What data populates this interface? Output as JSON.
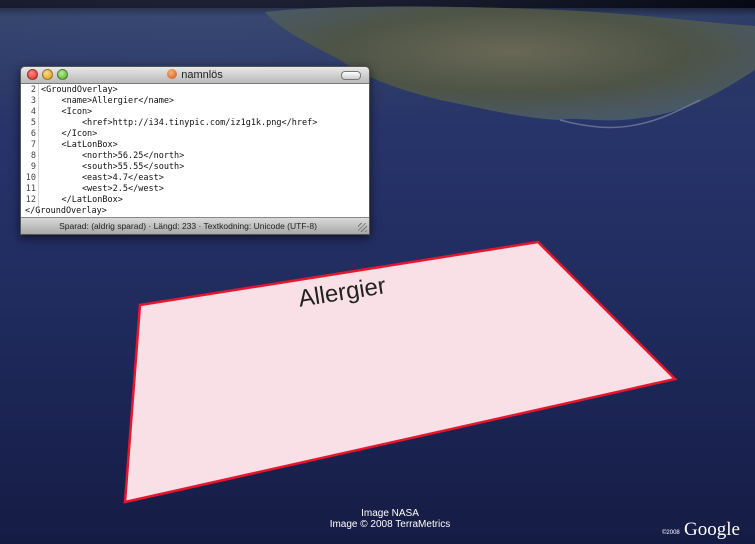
{
  "window": {
    "title": "namnlös",
    "status": "Sparad: (aldrig sparad) · Längd: 233 · Textkodning: Unicode (UTF-8)"
  },
  "editor": {
    "lines": [
      {
        "num": "2",
        "text": "<GroundOverlay>"
      },
      {
        "num": "3",
        "text": "    <name>Allergier</name>"
      },
      {
        "num": "4",
        "text": "    <Icon>"
      },
      {
        "num": "5",
        "text": "        <href>http://i34.tinypic.com/iz1g1k.png</href>"
      },
      {
        "num": "6",
        "text": "    </Icon>"
      },
      {
        "num": "7",
        "text": "    <LatLonBox>"
      },
      {
        "num": "8",
        "text": "        <north>56.25</north>"
      },
      {
        "num": "9",
        "text": "        <south>55.55</south>"
      },
      {
        "num": "10",
        "text": "        <east>4.7</east>"
      },
      {
        "num": "11",
        "text": "        <west>2.5</west>"
      },
      {
        "num": "12",
        "text": "    </LatLonBox>"
      },
      {
        "num": "",
        "text": "</GroundOverlay>"
      }
    ]
  },
  "overlay": {
    "label": "Allergier",
    "fill_color": "#f9dfe6",
    "border_color": "#e8162c"
  },
  "credits": {
    "line1": "Image NASA",
    "line2": "Image © 2008 TerraMetrics"
  },
  "logo": {
    "text": "Google",
    "year": "©2008"
  },
  "colors": {
    "sky_top": "#000010",
    "ocean": "#1a2450"
  }
}
